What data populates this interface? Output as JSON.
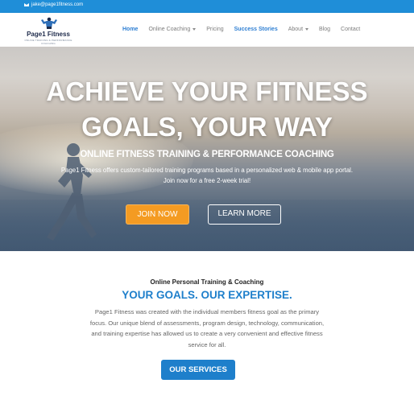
{
  "topbar": {
    "email_icon": "envelope-icon",
    "email": "jake@page1fitness.com"
  },
  "header": {
    "logo": {
      "name": "Page1 Fitness",
      "tagline": "ONLINE TRAINING & PERFORMANCE COACHING"
    },
    "nav": [
      {
        "label": "Home"
      },
      {
        "label": "Online Coaching"
      },
      {
        "label": "Pricing"
      },
      {
        "label": "Success Stories"
      },
      {
        "label": "About"
      },
      {
        "label": "Blog"
      },
      {
        "label": "Contact"
      }
    ]
  },
  "hero": {
    "title_line1": "ACHIEVE YOUR FITNESS",
    "title_line2": "GOALS, YOUR WAY",
    "subtitle": "ONLINE FITNESS TRAINING & PERFORMANCE COACHING",
    "text_line1": "Page1 Fitness offers custom-tailored training programs based in a personalized web & mobile app portal.",
    "text_line2": "Join now for a free 2-week trial!",
    "join_button": "JOIN NOW",
    "learn_button": "LEARN MORE"
  },
  "about": {
    "kicker": "Online Personal Training & Coaching",
    "title": "YOUR GOALS. OUR EXPERTISE.",
    "paragraph": "Page1 Fitness was created with the individual members fitness goal as the primary focus. Our unique blend of assessments, program design, technology, communication, and training expertise has allowed us to create a very convenient and effective fitness service for all.",
    "services_button": "OUR SERVICES"
  },
  "colors": {
    "topbar": "#1f8ed8",
    "nav_active": "#2e7fd3",
    "join_button": "#f49b22",
    "services_button": "#1e7fcb"
  }
}
